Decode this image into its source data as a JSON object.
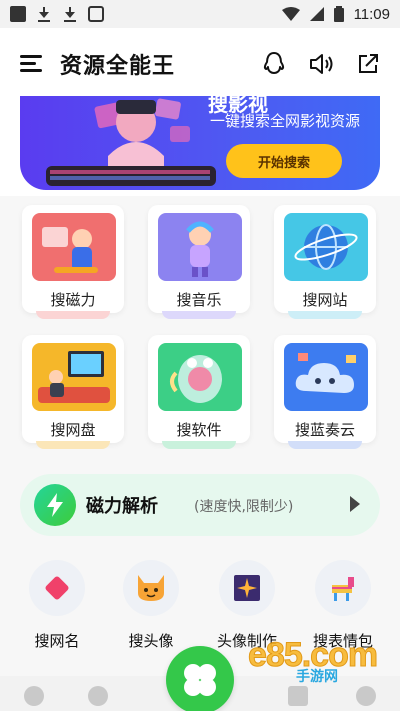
{
  "status_bar": {
    "time": "11:09"
  },
  "header": {
    "title": "资源全能王"
  },
  "banner": {
    "title": "搜影视",
    "subtitle": "一键搜索全网影视资源",
    "button_label": "开始搜索"
  },
  "grid": [
    {
      "label": "搜磁力"
    },
    {
      "label": "搜音乐"
    },
    {
      "label": "搜网站"
    },
    {
      "label": "搜网盘"
    },
    {
      "label": "搜软件"
    },
    {
      "label": "搜蓝奏云"
    }
  ],
  "magnet_bar": {
    "title": "磁力解析",
    "subtitle": "(速度快,限制少)"
  },
  "tools": [
    {
      "label": "搜网名"
    },
    {
      "label": "搜头像"
    },
    {
      "label": "头像制作"
    },
    {
      "label": "搜表情包"
    }
  ],
  "watermark": {
    "text": "e85.com",
    "sub": "手游网"
  },
  "colors": {
    "accent_green": "#34c84a",
    "banner_purple": "#5a3cf0",
    "button_yellow": "#ffc21a"
  }
}
